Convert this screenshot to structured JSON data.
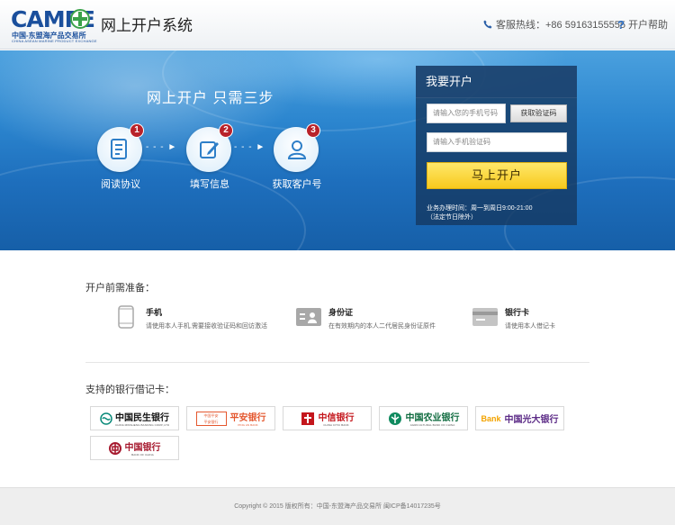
{
  "header": {
    "logo_text": "CAMPE",
    "logo_subtitle": "中国-东盟海产品交易所",
    "logo_english": "CHINA ASEAN MARINE PRODUCT EXCHANGE",
    "title": "网上开户系统",
    "hotline": "客服热线：+86 59163155555",
    "help": "开户帮助"
  },
  "banner": {
    "slogan": "网上开户  只需三步",
    "steps": [
      {
        "num": "1",
        "label": "阅读协议",
        "icon": "document-icon"
      },
      {
        "num": "2",
        "label": "填写信息",
        "icon": "edit-icon"
      },
      {
        "num": "3",
        "label": "获取客户号",
        "icon": "user-icon"
      }
    ]
  },
  "signup": {
    "title": "我要开户",
    "phone_placeholder": "请输入您的手机号码",
    "get_code": "获取验证码",
    "code_placeholder": "请输入手机验证码",
    "submit": "马上开户",
    "hours_line1": "业务办理时间：周一到周日9:00-21:00",
    "hours_line2": "（法定节日除外）"
  },
  "prep": {
    "title": "开户前需准备：",
    "items": [
      {
        "title": "手机",
        "desc": "请使用本人手机,需要接收验证码和回访激活",
        "icon": "phone-icon"
      },
      {
        "title": "身份证",
        "desc": "在有效期内的本人二代居民身份证原件",
        "icon": "id-card-icon"
      },
      {
        "title": "银行卡",
        "desc": "请使用本人借记卡",
        "icon": "bank-card-icon"
      }
    ]
  },
  "banks": {
    "title": "支持的银行借记卡：",
    "list": [
      {
        "name": "中国民生银行",
        "en": "CHINA MINSHENG BANKING CORP.,LTD"
      },
      {
        "name": "平安银行",
        "en": "PING AN BANK"
      },
      {
        "name": "中信银行",
        "en": "CHINA CITIC BANK"
      },
      {
        "name": "中国农业银行",
        "en": "AGRICULTURAL BANK OF CHINA"
      },
      {
        "name": "中国光大银行",
        "en": "Bank"
      },
      {
        "name": "中国银行",
        "en": "BANK OF CHINA"
      }
    ]
  },
  "footer": {
    "text": "Copyright © 2015   版权所有：中国-东盟海产品交易所   闽ICP备14017235号"
  },
  "colors": {
    "brand_blue": "#1a4f9c",
    "badge_red": "#b8222a",
    "submit_yellow": "#f7c91d"
  }
}
